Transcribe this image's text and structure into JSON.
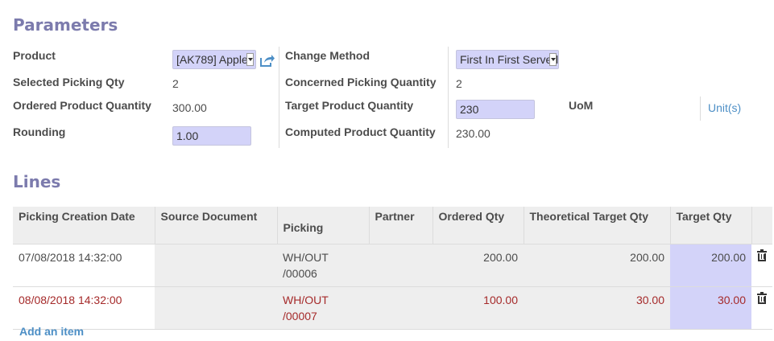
{
  "parameters": {
    "title": "Parameters",
    "product_label": "Product",
    "product_value": "[AK789] Apple",
    "selected_picking_qty_label": "Selected Picking Qty",
    "selected_picking_qty_value": "2",
    "ordered_product_quantity_label": "Ordered Product Quantity",
    "ordered_product_quantity_value": "300.00",
    "rounding_label": "Rounding",
    "rounding_value": "1.00",
    "change_method_label": "Change Method",
    "change_method_value": "First In First Served",
    "concerned_picking_quantity_label": "Concerned Picking Quantity",
    "concerned_picking_quantity_value": "2",
    "target_product_quantity_label": "Target Product Quantity",
    "target_product_quantity_value": "230",
    "computed_product_quantity_label": "Computed Product Quantity",
    "computed_product_quantity_value": "230.00",
    "uom_label": "UoM",
    "uom_value": "Unit(s)"
  },
  "lines": {
    "title": "Lines",
    "columns": [
      "Picking Creation Date",
      "Source Document",
      "Picking",
      "Partner",
      "Ordered Qty",
      "Theoretical Target Qty",
      "Target Qty"
    ],
    "rows": [
      {
        "date": "07/08/2018 14:32:00",
        "source": "",
        "picking_1": "WH/OUT",
        "picking_2": "/00006",
        "partner": "",
        "ordered": "200.00",
        "theoretical": "200.00",
        "target": "200.00"
      },
      {
        "date": "08/08/2018 14:32:00",
        "source": "",
        "picking_1": "WH/OUT",
        "picking_2": "/00007",
        "partner": "",
        "ordered": "100.00",
        "theoretical": "30.00",
        "target": "30.00"
      }
    ],
    "add_item_label": "Add an item"
  },
  "icons": {
    "external_link": "external-link-icon",
    "delete": "trash-icon",
    "dropdown": "caret-down-icon"
  },
  "colors": {
    "title": "#7c7bad",
    "input_bg": "#d3d3f9",
    "link": "#4d8fc6",
    "late_row": "#a52a2a"
  }
}
